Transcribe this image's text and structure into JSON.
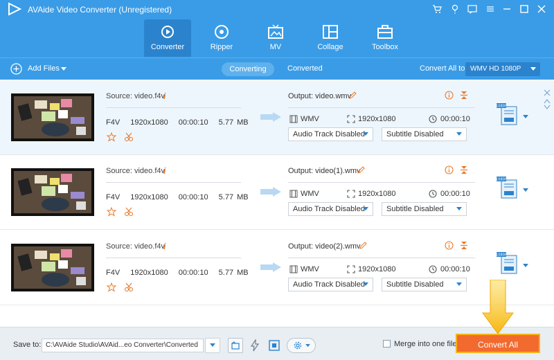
{
  "app": {
    "title": "AVAide Video Converter (Unregistered)"
  },
  "nav": [
    {
      "label": "Converter",
      "icon": "converter-icon"
    },
    {
      "label": "Ripper",
      "icon": "ripper-icon"
    },
    {
      "label": "MV",
      "icon": "mv-icon"
    },
    {
      "label": "Collage",
      "icon": "collage-icon"
    },
    {
      "label": "Toolbox",
      "icon": "toolbox-icon"
    }
  ],
  "toolbar": {
    "add_files": "Add Files",
    "tab_converting": "Converting",
    "tab_converted": "Converted",
    "convert_all_to": "Convert All to:",
    "format": "WMV HD 1080P"
  },
  "rows": [
    {
      "source": "Source: video.f4v",
      "format": "F4V",
      "res": "1920x1080",
      "dur": "00:00:10",
      "size": "5.77 MB",
      "output": "Output: video.wmv",
      "out_fmt": "WMV",
      "out_res": "1920x1080",
      "out_dur": "00:00:10",
      "audio": "Audio Track Disabled",
      "subtitle": "Subtitle Disabled",
      "badge": "1080P"
    },
    {
      "source": "Source: video.f4v",
      "format": "F4V",
      "res": "1920x1080",
      "dur": "00:00:10",
      "size": "5.77 MB",
      "output": "Output: video(1).wmv",
      "out_fmt": "WMV",
      "out_res": "1920x1080",
      "out_dur": "00:00:10",
      "audio": "Audio Track Disabled",
      "subtitle": "Subtitle Disabled",
      "badge": "1080P"
    },
    {
      "source": "Source: video.f4v",
      "format": "F4V",
      "res": "1920x1080",
      "dur": "00:00:10",
      "size": "5.77 MB",
      "output": "Output: video(2).wmv",
      "out_fmt": "WMV",
      "out_res": "1920x1080",
      "out_dur": "00:00:10",
      "audio": "Audio Track Disabled",
      "subtitle": "Subtitle Disabled",
      "badge": "1080P"
    }
  ],
  "footer": {
    "save_to": "Save to:",
    "path": "C:\\AVAide Studio\\AVAid...eo Converter\\Converted",
    "merge": "Merge into one file",
    "convert_all": "Convert All"
  },
  "colors": {
    "header": "#3a9ce6",
    "accent": "#f26a2e",
    "highlight": "#f8b418"
  }
}
